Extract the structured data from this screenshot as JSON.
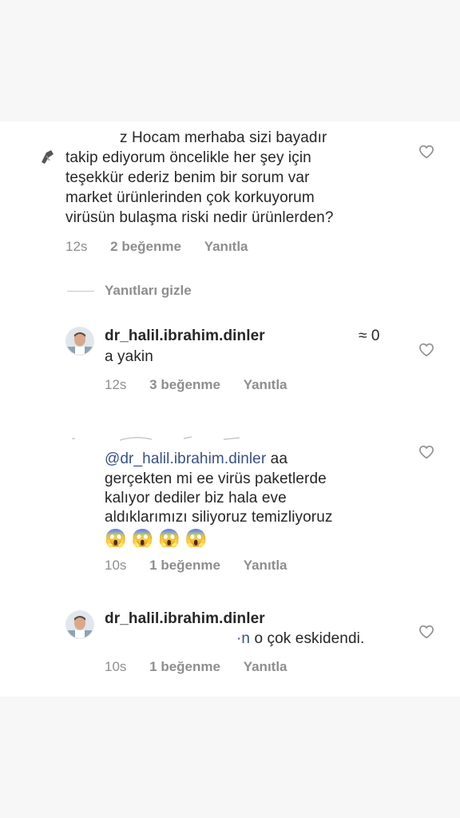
{
  "comments": [
    {
      "text_lines": [
        "z Hocam merhaba sizi bayadır",
        "takip ediyorum öncelikle her şey için",
        "teşekkür ederiz benim bir sorum var",
        "market ürünlerinden çok korkuyorum",
        "virüsün bulaşma riski nedir ürünlerden?"
      ],
      "time": "12s",
      "likes": "2 beğenme",
      "reply": "Yanıtla"
    }
  ],
  "hide_replies": "Yanıtları gizle",
  "replies": [
    {
      "username": "dr_halil.ibrahim.dinler",
      "tail": "≈ 0",
      "line2": "a yakin",
      "time": "12s",
      "likes": "3 beğenme",
      "reply": "Yanıtla"
    },
    {
      "mention": "@dr_halil.ibrahim.dinler",
      "line1_rest": " aa",
      "lines": [
        "gerçekten mi ee virüs paketlerde",
        "kalıyor dediler biz hala eve",
        "aldıklarımızı siliyoruz temizliyoruz"
      ],
      "emojis": "😱 😱 😱 😱",
      "time": "10s",
      "likes": "1 beğenme",
      "reply": "Yanıtla"
    },
    {
      "username": "dr_halil.ibrahim.dinler",
      "line2_prefix": "·n",
      "line2_rest": " o çok eskidendi.",
      "time": "10s",
      "likes": "1 beğenme",
      "reply": "Yanıtla"
    }
  ]
}
